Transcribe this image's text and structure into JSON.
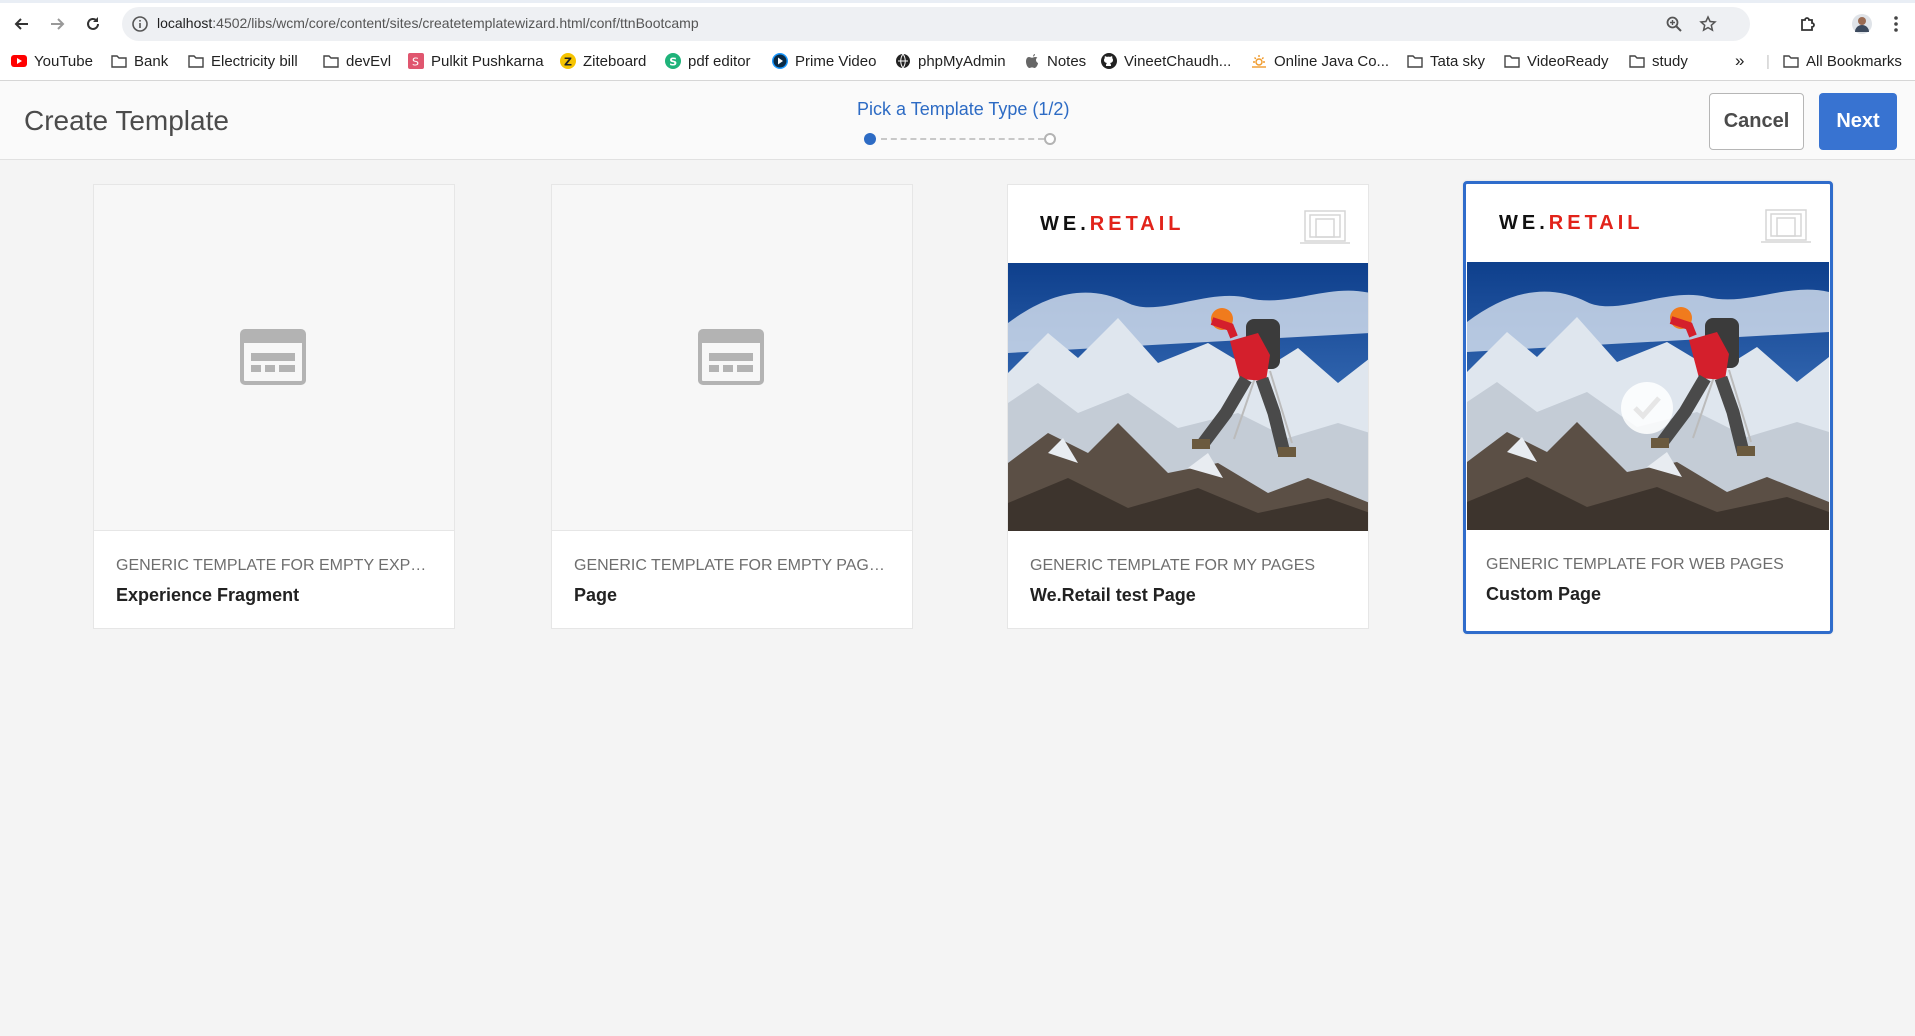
{
  "browser": {
    "url_host": "localhost",
    "url_rest": ":4502/libs/wcm/core/content/sites/createtemplatewizard.html/conf/ttnBootcamp",
    "bookmarks": [
      {
        "label": "YouTube",
        "icon": "youtube-icon"
      },
      {
        "label": "Bank",
        "icon": "folder-icon"
      },
      {
        "label": "Electricity bill",
        "icon": "folder-icon"
      },
      {
        "label": "devEvl",
        "icon": "folder-icon"
      },
      {
        "label": "Pulkit Pushkarna",
        "icon": "s-favicon-icon"
      },
      {
        "label": "Ziteboard",
        "icon": "z-favicon-icon"
      },
      {
        "label": "pdf editor",
        "icon": "s-green-favicon-icon"
      },
      {
        "label": "Prime Video",
        "icon": "prime-video-icon"
      },
      {
        "label": "phpMyAdmin",
        "icon": "globe-icon"
      },
      {
        "label": "Notes",
        "icon": "apple-icon"
      },
      {
        "label": "VineetChaudh...",
        "icon": "github-icon"
      },
      {
        "label": "Online Java Co...",
        "icon": "sun-icon"
      },
      {
        "label": "Tata sky",
        "icon": "folder-icon"
      },
      {
        "label": "VideoReady",
        "icon": "folder-icon"
      },
      {
        "label": "study",
        "icon": "folder-icon"
      }
    ],
    "overflow_label": "»",
    "all_bookmarks": "All Bookmarks"
  },
  "header": {
    "title": "Create Template",
    "step_label": "Pick a Template Type (1/2)",
    "cancel_label": "Cancel",
    "next_label": "Next"
  },
  "cards": [
    {
      "subtitle": "GENERIC TEMPLATE FOR EMPTY EXPERI...",
      "name": "Experience Fragment",
      "thumb": "placeholder",
      "selected": false
    },
    {
      "subtitle": "GENERIC TEMPLATE FOR EMPTY PAGES ...",
      "name": "Page",
      "thumb": "placeholder",
      "selected": false
    },
    {
      "subtitle": "GENERIC TEMPLATE FOR MY PAGES",
      "name": "We.Retail test Page",
      "thumb": "we-retail",
      "selected": false
    },
    {
      "subtitle": "GENERIC TEMPLATE FOR WEB PAGES",
      "name": "Custom Page",
      "thumb": "we-retail",
      "selected": true
    }
  ],
  "brand": {
    "we": "WE",
    "dot": ".",
    "retail": "RETAIL"
  },
  "colors": {
    "accent": "#3873d1",
    "brand_red": "#e2231a"
  }
}
